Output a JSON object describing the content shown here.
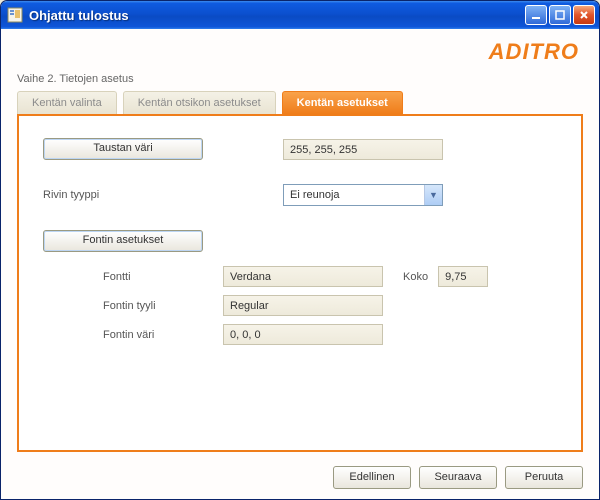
{
  "window": {
    "title": "Ohjattu tulostus"
  },
  "brand": "ADITRO",
  "step": "Vaihe 2. Tietojen asetus",
  "tabs": {
    "field_select": "Kentän valinta",
    "header_settings": "Kentän otsikon asetukset",
    "field_settings": "Kentän asetukset"
  },
  "panel": {
    "background_color_btn": "Taustan väri",
    "background_color_value": "255, 255, 255",
    "row_type_label": "Rivin tyyppi",
    "row_type_value": "Ei reunoja",
    "font_settings_btn": "Fontin asetukset",
    "font_label": "Fontti",
    "font_value": "Verdana",
    "font_style_label": "Fontin tyyli",
    "font_style_value": "Regular",
    "font_color_label": "Fontin väri",
    "font_color_value": "0, 0, 0",
    "size_label": "Koko",
    "size_value": "9,75"
  },
  "footer": {
    "prev": "Edellinen",
    "next": "Seuraava",
    "cancel": "Peruuta"
  }
}
